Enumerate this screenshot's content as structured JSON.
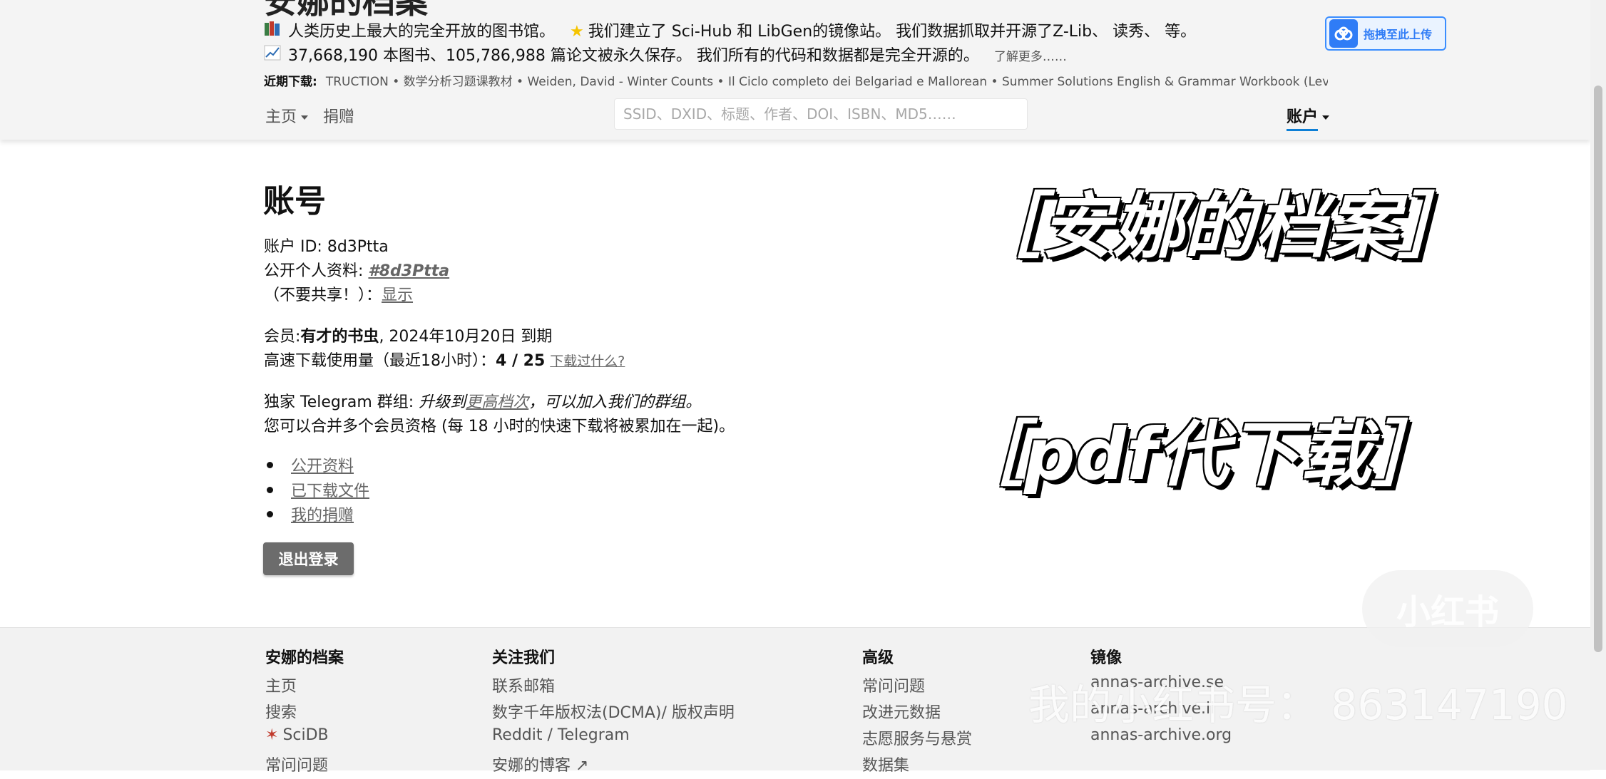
{
  "header": {
    "site_title": "安娜的档案",
    "info_line_1": {
      "icon": "books-emoji",
      "text_a": "人类历史上最大的完全开放的图书馆。",
      "star_icon": "star-emoji",
      "text_b": "我们建立了 Sci-Hub 和 LibGen的镜像站。 我们数据抓取并开源了Z-Lib、 读秀、 等。"
    },
    "info_line_2": {
      "icon": "chart-emoji",
      "text": "37,668,190 本图书、105,786,988 篇论文被永久保存。 我们所有的代码和数据都是完全开源的。",
      "learn_more": "了解更多……"
    },
    "recent_downloads": {
      "label": "近期下载:",
      "items": "TRUCTION • 数学分析习题课教材 • Weiden, David - Winter Counts • Il Ciclo completo dei Belgariad e Mallorean • Summer Solutions English & Grammar Workbook (Lev"
    },
    "upload_button": "拖拽至此上传",
    "nav": {
      "home": "主页",
      "donate": "捐赠",
      "search_placeholder": "SSID、DXID、标题、作者、DOI、ISBN、MD5……",
      "account": "账户"
    }
  },
  "main": {
    "title": "账号",
    "account_id": "账户 ID: 8d3Ptta",
    "public_profile_label": "公开个人资料:",
    "public_profile_link": "#8d3Ptta",
    "secret_label": "（不要共享！）：",
    "secret_link": "显示",
    "membership_label": "会员:",
    "membership_tier": "有才的书虫",
    "membership_expiry": ", 2024年10月20日 到期",
    "fast_download_label": "高速下载使用量（最近18小时）：",
    "fast_download_value": "4 / 25",
    "fast_download_link": "下载过什么?",
    "telegram_label": "独家 Telegram 群组:",
    "telegram_text_a": "升级到",
    "telegram_link": "更高档次",
    "telegram_text_b": "，可以加入我们的群组。",
    "combine_text": "您可以合并多个会员资格 (每 18 小时的快速下载将被累加在一起)。",
    "links": [
      "公开资料",
      "已下载文件",
      "我的捐赠"
    ],
    "logout_button": "退出登录"
  },
  "overlay": {
    "title": "［安娜的档案］",
    "subtitle": "［pdf代下载］",
    "watermark_logo": "小红书",
    "watermark_id": "我的小红书号： 863147190"
  },
  "footer": {
    "col1": {
      "heading": "安娜的档案",
      "links": [
        "主页",
        "搜索",
        "SciDB",
        "常问问题"
      ]
    },
    "col2": {
      "heading": "关注我们",
      "links": [
        "联系邮箱",
        "数字千年版权法(DCMA)/ 版权声明",
        "Reddit / Telegram",
        "安娜的博客 ↗"
      ]
    },
    "col3": {
      "heading": "高级",
      "links": [
        "常问问题",
        "改进元数据",
        "志愿服务与悬赏",
        "数据集"
      ]
    },
    "col4": {
      "heading": "镜像",
      "links": [
        "annas-archive.se",
        "annas-archive.li",
        "annas-archive.org"
      ]
    }
  },
  "colors": {
    "header_bg": "#f4f4f4",
    "accent_underline": "#0d7fd6",
    "logout_bg": "#6c6c6c",
    "upload_blue": "#2f7cf6"
  }
}
